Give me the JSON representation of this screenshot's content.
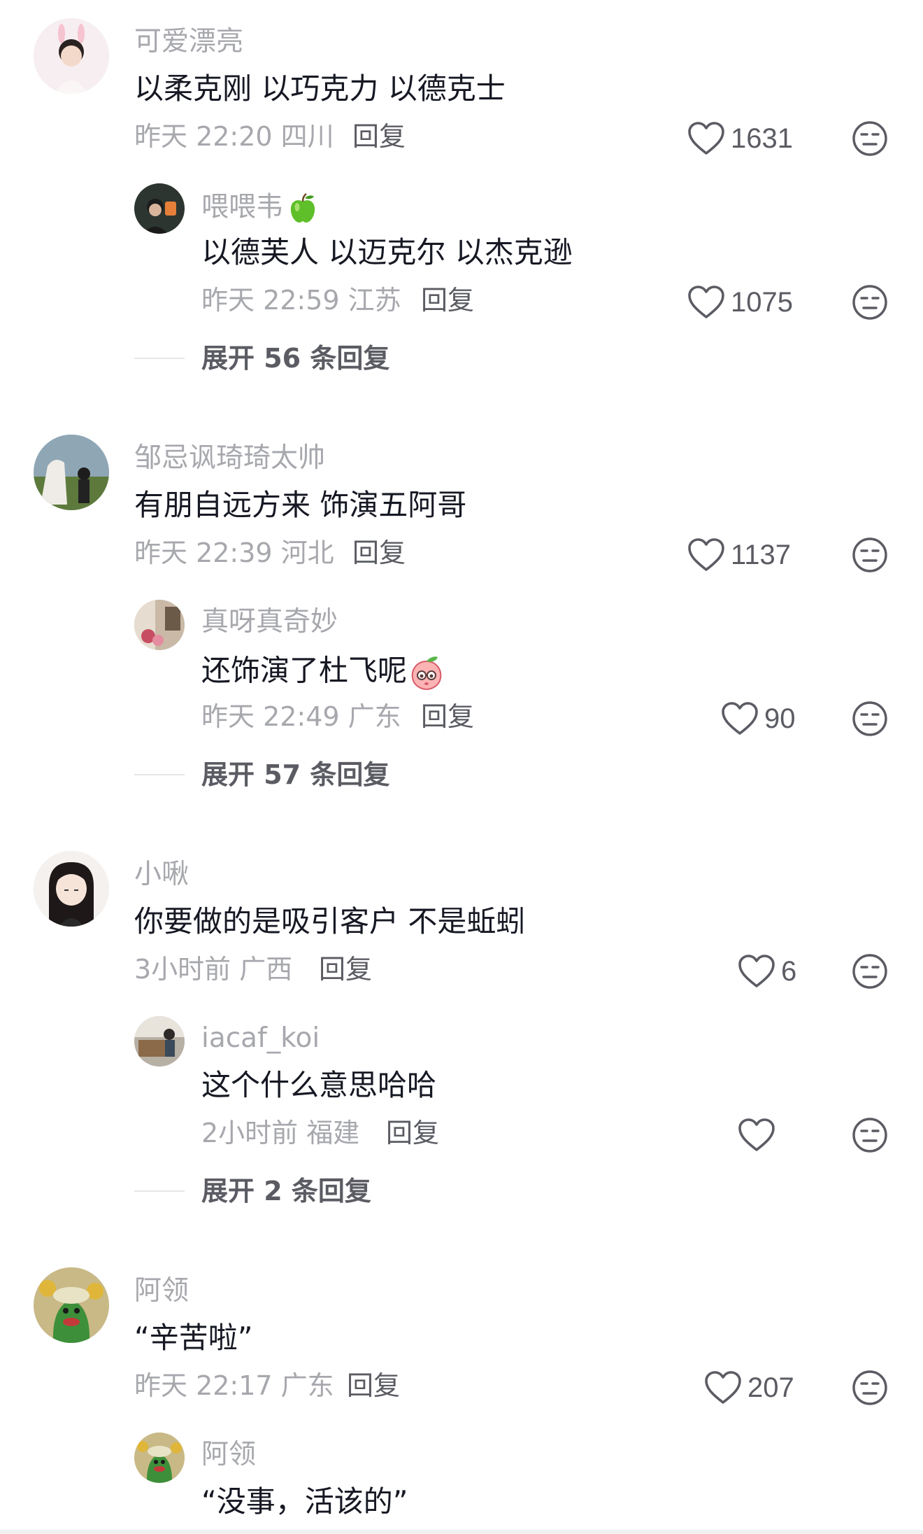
{
  "reply_label": "回复",
  "threads": [
    {
      "comment": {
        "username": "可爱漂亮",
        "text": "以柔克刚 以巧克力 以德克士",
        "meta": "昨天 22:20 四川",
        "likes": "1631"
      },
      "reply": {
        "username": "喂喂韦",
        "text": "以德芙人 以迈克尔 以杰克逊",
        "meta": "昨天 22:59 江苏",
        "likes": "1075"
      },
      "expand": "展开 56 条回复"
    },
    {
      "comment": {
        "username": "邹忌讽琦琦太帅",
        "text": "有朋自远方来 饰演五阿哥",
        "meta": "昨天 22:39 河北",
        "likes": "1137"
      },
      "reply": {
        "username": "真呀真奇妙",
        "text": "还饰演了杜飞呢",
        "meta": "昨天 22:49 广东",
        "likes": "90"
      },
      "expand": "展开 57 条回复"
    },
    {
      "comment": {
        "username": "小啾",
        "text": "你要做的是吸引客户 不是蚯蚓",
        "meta": "3小时前 广西",
        "likes": "6"
      },
      "reply": {
        "username": "iacaf_koi",
        "text": "这个什么意思哈哈",
        "meta": "2小时前 福建",
        "likes": ""
      },
      "expand": "展开 2 条回复"
    },
    {
      "comment": {
        "username": "阿领",
        "text": "“辛苦啦”",
        "meta": "昨天 22:17 广东",
        "likes": "207"
      },
      "reply": {
        "username": "阿领",
        "text": "“没事，活该的”",
        "meta": "",
        "likes": ""
      }
    }
  ],
  "icons": {
    "like": "heart-outline-icon",
    "dislike": "meh-face-icon",
    "apple": "green-apple-emoji",
    "peach": "peach-emoji"
  },
  "colors": {
    "username": "#a7a8ad",
    "content": "#161823",
    "meta": "#a7a8ad",
    "action": "#5b5c63"
  }
}
